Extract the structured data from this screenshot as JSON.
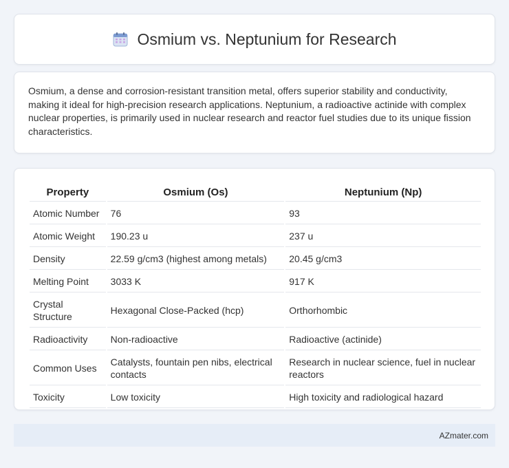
{
  "header": {
    "title": "Osmium vs. Neptunium for Research",
    "icon": "calendar-icon"
  },
  "description": "Osmium, a dense and corrosion-resistant transition metal, offers superior stability and conductivity, making it ideal for high-precision research applications. Neptunium, a radioactive actinide with complex nuclear properties, is primarily used in nuclear research and reactor fuel studies due to its unique fission characteristics.",
  "table": {
    "headers": [
      "Property",
      "Osmium (Os)",
      "Neptunium (Np)"
    ],
    "rows": [
      [
        "Atomic Number",
        "76",
        "93"
      ],
      [
        "Atomic Weight",
        "190.23 u",
        "237 u"
      ],
      [
        "Density",
        "22.59 g/cm3 (highest among metals)",
        "20.45 g/cm3"
      ],
      [
        "Melting Point",
        "3033 K",
        "917 K"
      ],
      [
        "Crystal Structure",
        "Hexagonal Close-Packed (hcp)",
        "Orthorhombic"
      ],
      [
        "Radioactivity",
        "Non-radioactive",
        "Radioactive (actinide)"
      ],
      [
        "Common Uses",
        "Catalysts, fountain pen nibs, electrical contacts",
        "Research in nuclear science, fuel in nuclear reactors"
      ],
      [
        "Toxicity",
        "Low toxicity",
        "High toxicity and radiological hazard"
      ]
    ]
  },
  "footer": {
    "brand": "AZmater.com"
  }
}
